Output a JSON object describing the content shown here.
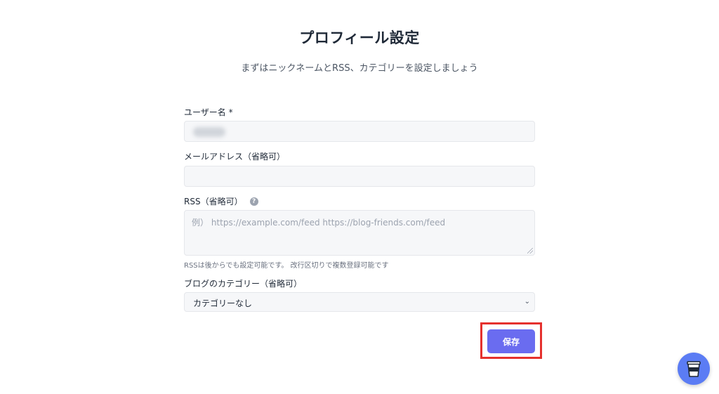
{
  "header": {
    "title": "プロフィール設定",
    "subtitle": "まずはニックネームとRSS、カテゴリーを設定しましょう"
  },
  "form": {
    "username": {
      "label": "ユーザー名 *",
      "value": ""
    },
    "email": {
      "label": "メールアドレス（省略可）",
      "value": ""
    },
    "rss": {
      "label": "RSS（省略可）",
      "help_icon": "question-circle-icon",
      "placeholder": "例） https://example.com/feed https://blog-friends.com/feed",
      "hint": "RSSは後からでも設定可能です。 改行区切りで複数登録可能です"
    },
    "category": {
      "label": "ブログのカテゴリー（省略可）",
      "selected": "カテゴリーなし"
    },
    "save_label": "保存"
  },
  "fab": {
    "icon": "coffee-cup-icon"
  },
  "colors": {
    "accent": "#6a6cf0",
    "highlight": "#e5312e",
    "fab": "#5b7cf4"
  }
}
